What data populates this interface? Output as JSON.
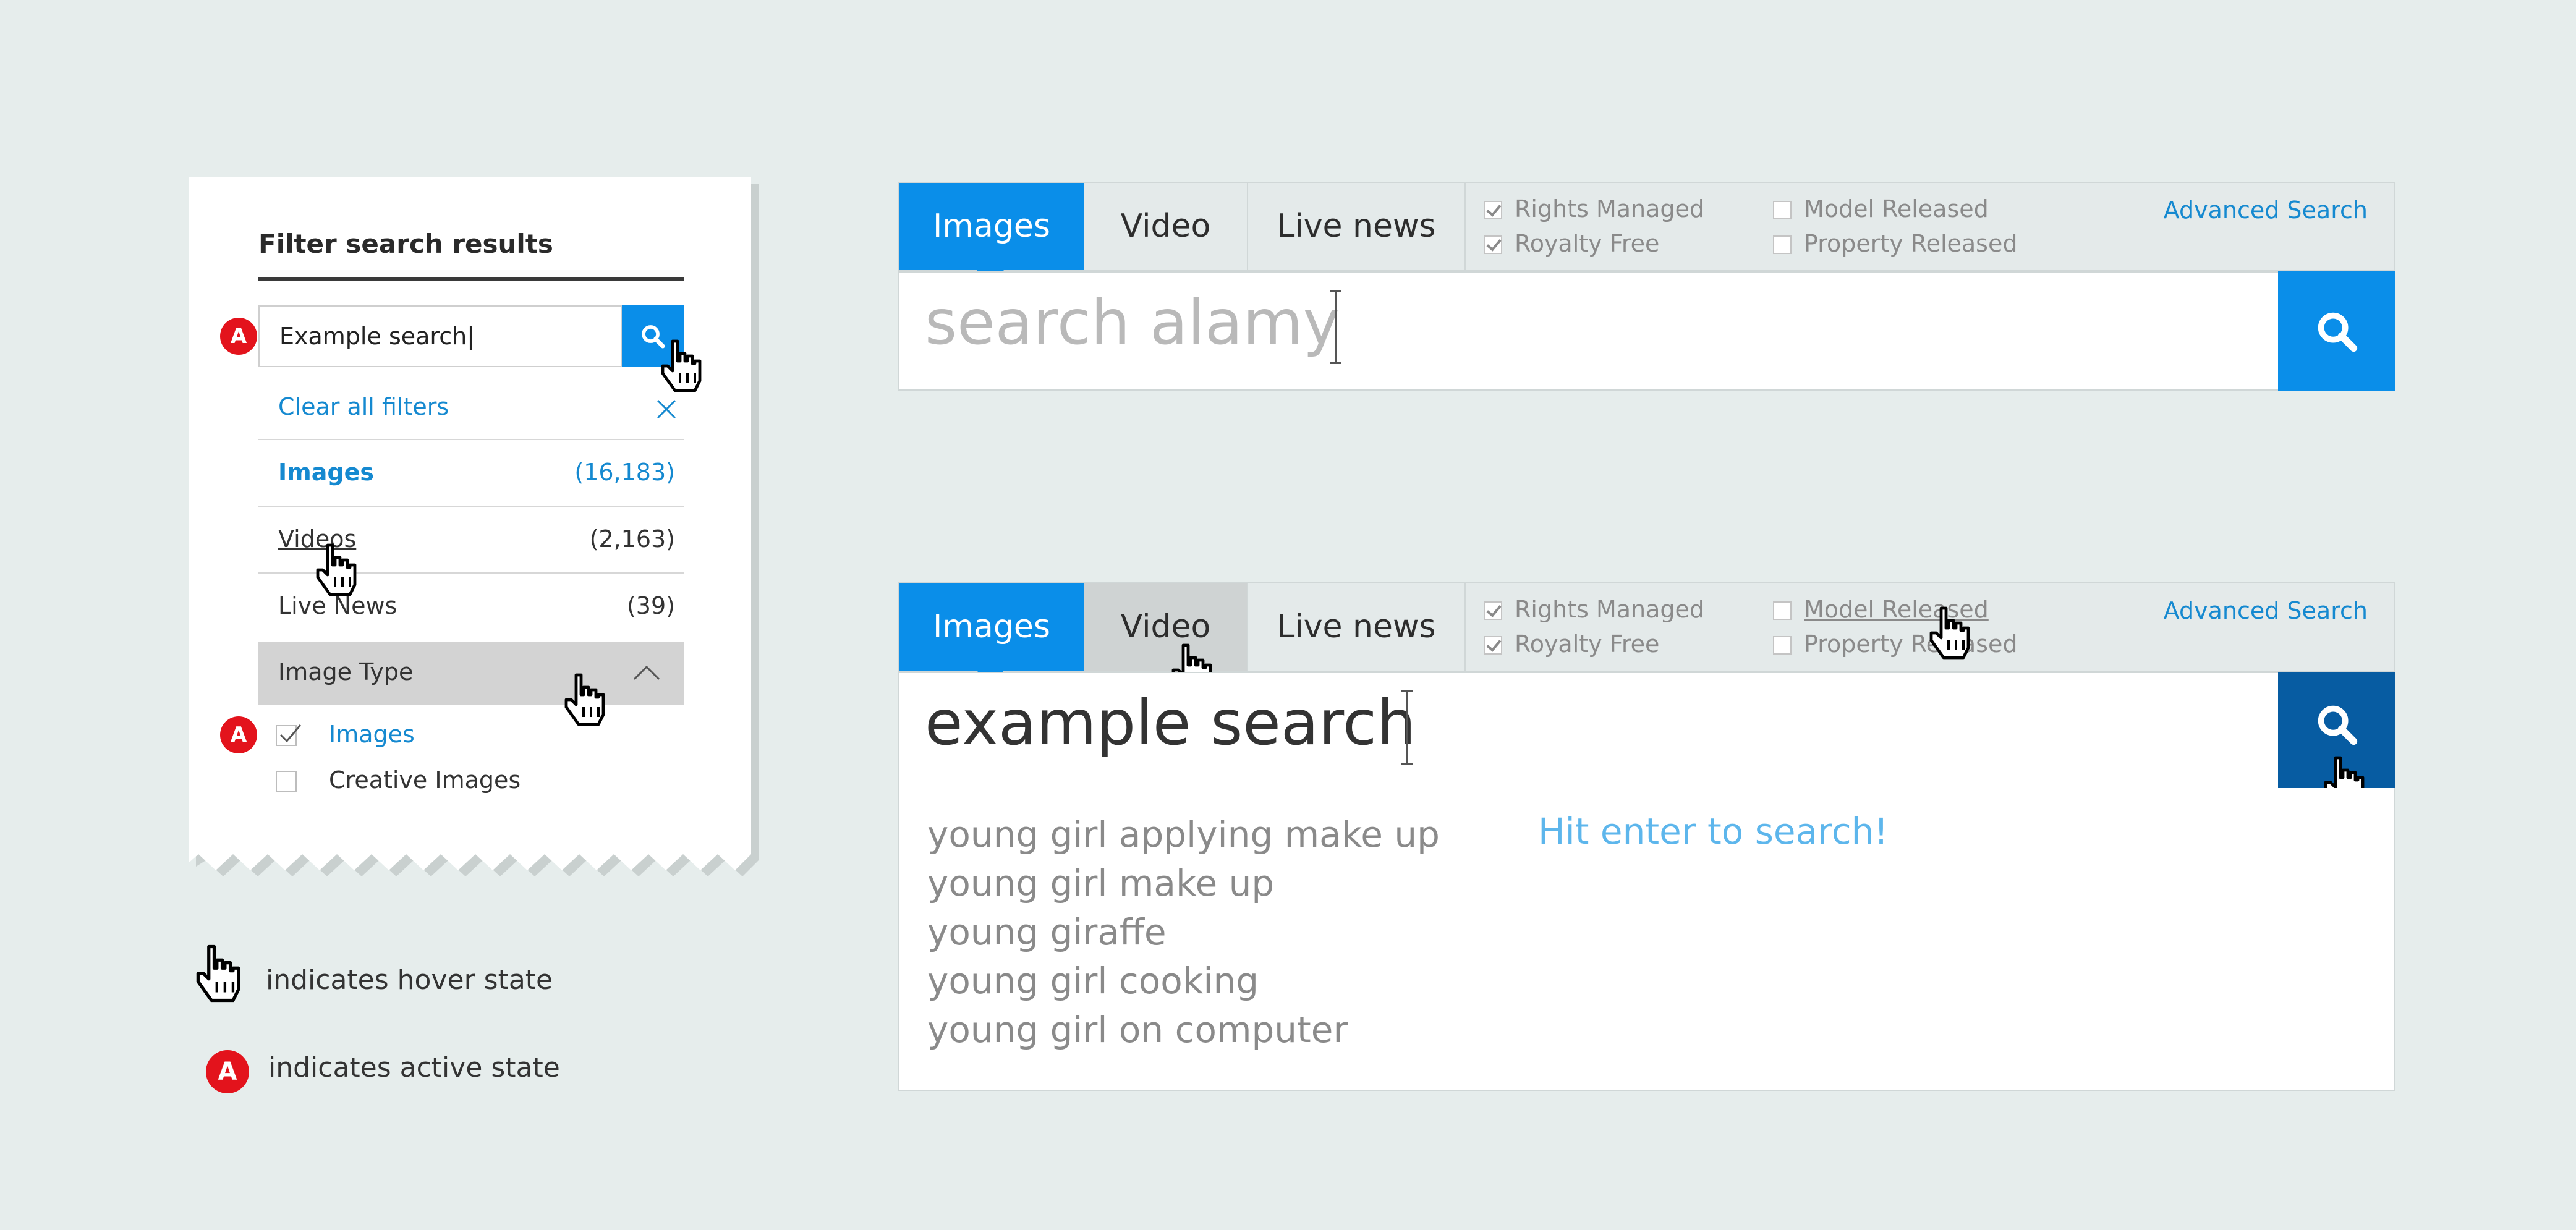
{
  "colors": {
    "background": "#e6edec",
    "accent": "#0a8ee9",
    "accent_dark": "#075ca2",
    "active_badge": "#e3131c",
    "link": "#1589d0",
    "hint": "#5db6ec"
  },
  "icons": [
    "search-icon",
    "hand-cursor-icon",
    "close-icon",
    "chevron-up-icon",
    "checkbox-icon",
    "text-cursor-icon"
  ],
  "filter_panel": {
    "title": "Filter search results",
    "search_value": "Example search|",
    "active_badge": "A",
    "clear_label": "Clear all filters",
    "rows": [
      {
        "label": "Images",
        "count": "(16,183)"
      },
      {
        "label": "Videos",
        "count": "(2,163)"
      },
      {
        "label": "Live News",
        "count": "(39)"
      }
    ],
    "section_label": "Image Type",
    "options": [
      {
        "label": "Images",
        "checked": true
      },
      {
        "label": "Creative Images",
        "checked": false
      }
    ]
  },
  "legend": {
    "hover_text": "indicates hover state",
    "active_badge": "A",
    "active_text": "indicates active state"
  },
  "search_bar_1": {
    "tabs": [
      "Images",
      "Video",
      "Live news"
    ],
    "checks": [
      {
        "label": "Rights Managed",
        "checked": true
      },
      {
        "label": "Royalty Free",
        "checked": true
      },
      {
        "label": "Model Released",
        "checked": false
      },
      {
        "label": "Property Released",
        "checked": false
      }
    ],
    "advanced": "Advanced Search",
    "placeholder": "search alamy"
  },
  "search_bar_2": {
    "tabs": [
      "Images",
      "Video",
      "Live news"
    ],
    "checks": [
      {
        "label": "Rights Managed",
        "checked": true
      },
      {
        "label": "Royalty Free",
        "checked": true
      },
      {
        "label": "Model Released",
        "checked": false
      },
      {
        "label": "Property Released",
        "checked": false
      }
    ],
    "advanced": "Advanced Search",
    "value": "example search",
    "suggestions": [
      "young girl applying make up",
      "young girl make up",
      "young giraffe",
      "young girl cooking",
      "young girl on computer"
    ],
    "hint": "Hit enter to search!"
  }
}
